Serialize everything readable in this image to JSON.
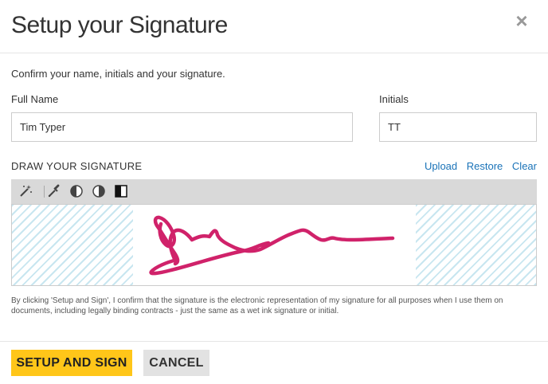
{
  "dialog": {
    "title": "Setup your Signature",
    "close_glyph": "×",
    "intro": "Confirm your name, initials and your signature."
  },
  "fields": {
    "full_name_label": "Full Name",
    "full_name_value": "Tim Typer",
    "initials_label": "Initials",
    "initials_value": "TT"
  },
  "draw": {
    "title": "DRAW YOUR SIGNATURE",
    "links": {
      "upload": "Upload",
      "restore": "Restore",
      "clear": "Clear"
    }
  },
  "toolbar": {
    "icons": [
      "magic-wand-icon",
      "eyedropper-icon",
      "contrast-low-icon",
      "contrast-medium-icon",
      "contrast-high-icon"
    ]
  },
  "colors": {
    "signature_ink": "#d0226a",
    "link": "#1a73b8",
    "primary_button": "#ffc619",
    "hatch": "#c8e6f0"
  },
  "legal": "By clicking 'Setup and Sign', I confirm that the signature is the electronic representation of my signature for all purposes when I use them on documents, including legally binding contracts - just the same as a wet ink signature or initial.",
  "buttons": {
    "setup": "SETUP AND SIGN",
    "cancel": "CANCEL"
  }
}
